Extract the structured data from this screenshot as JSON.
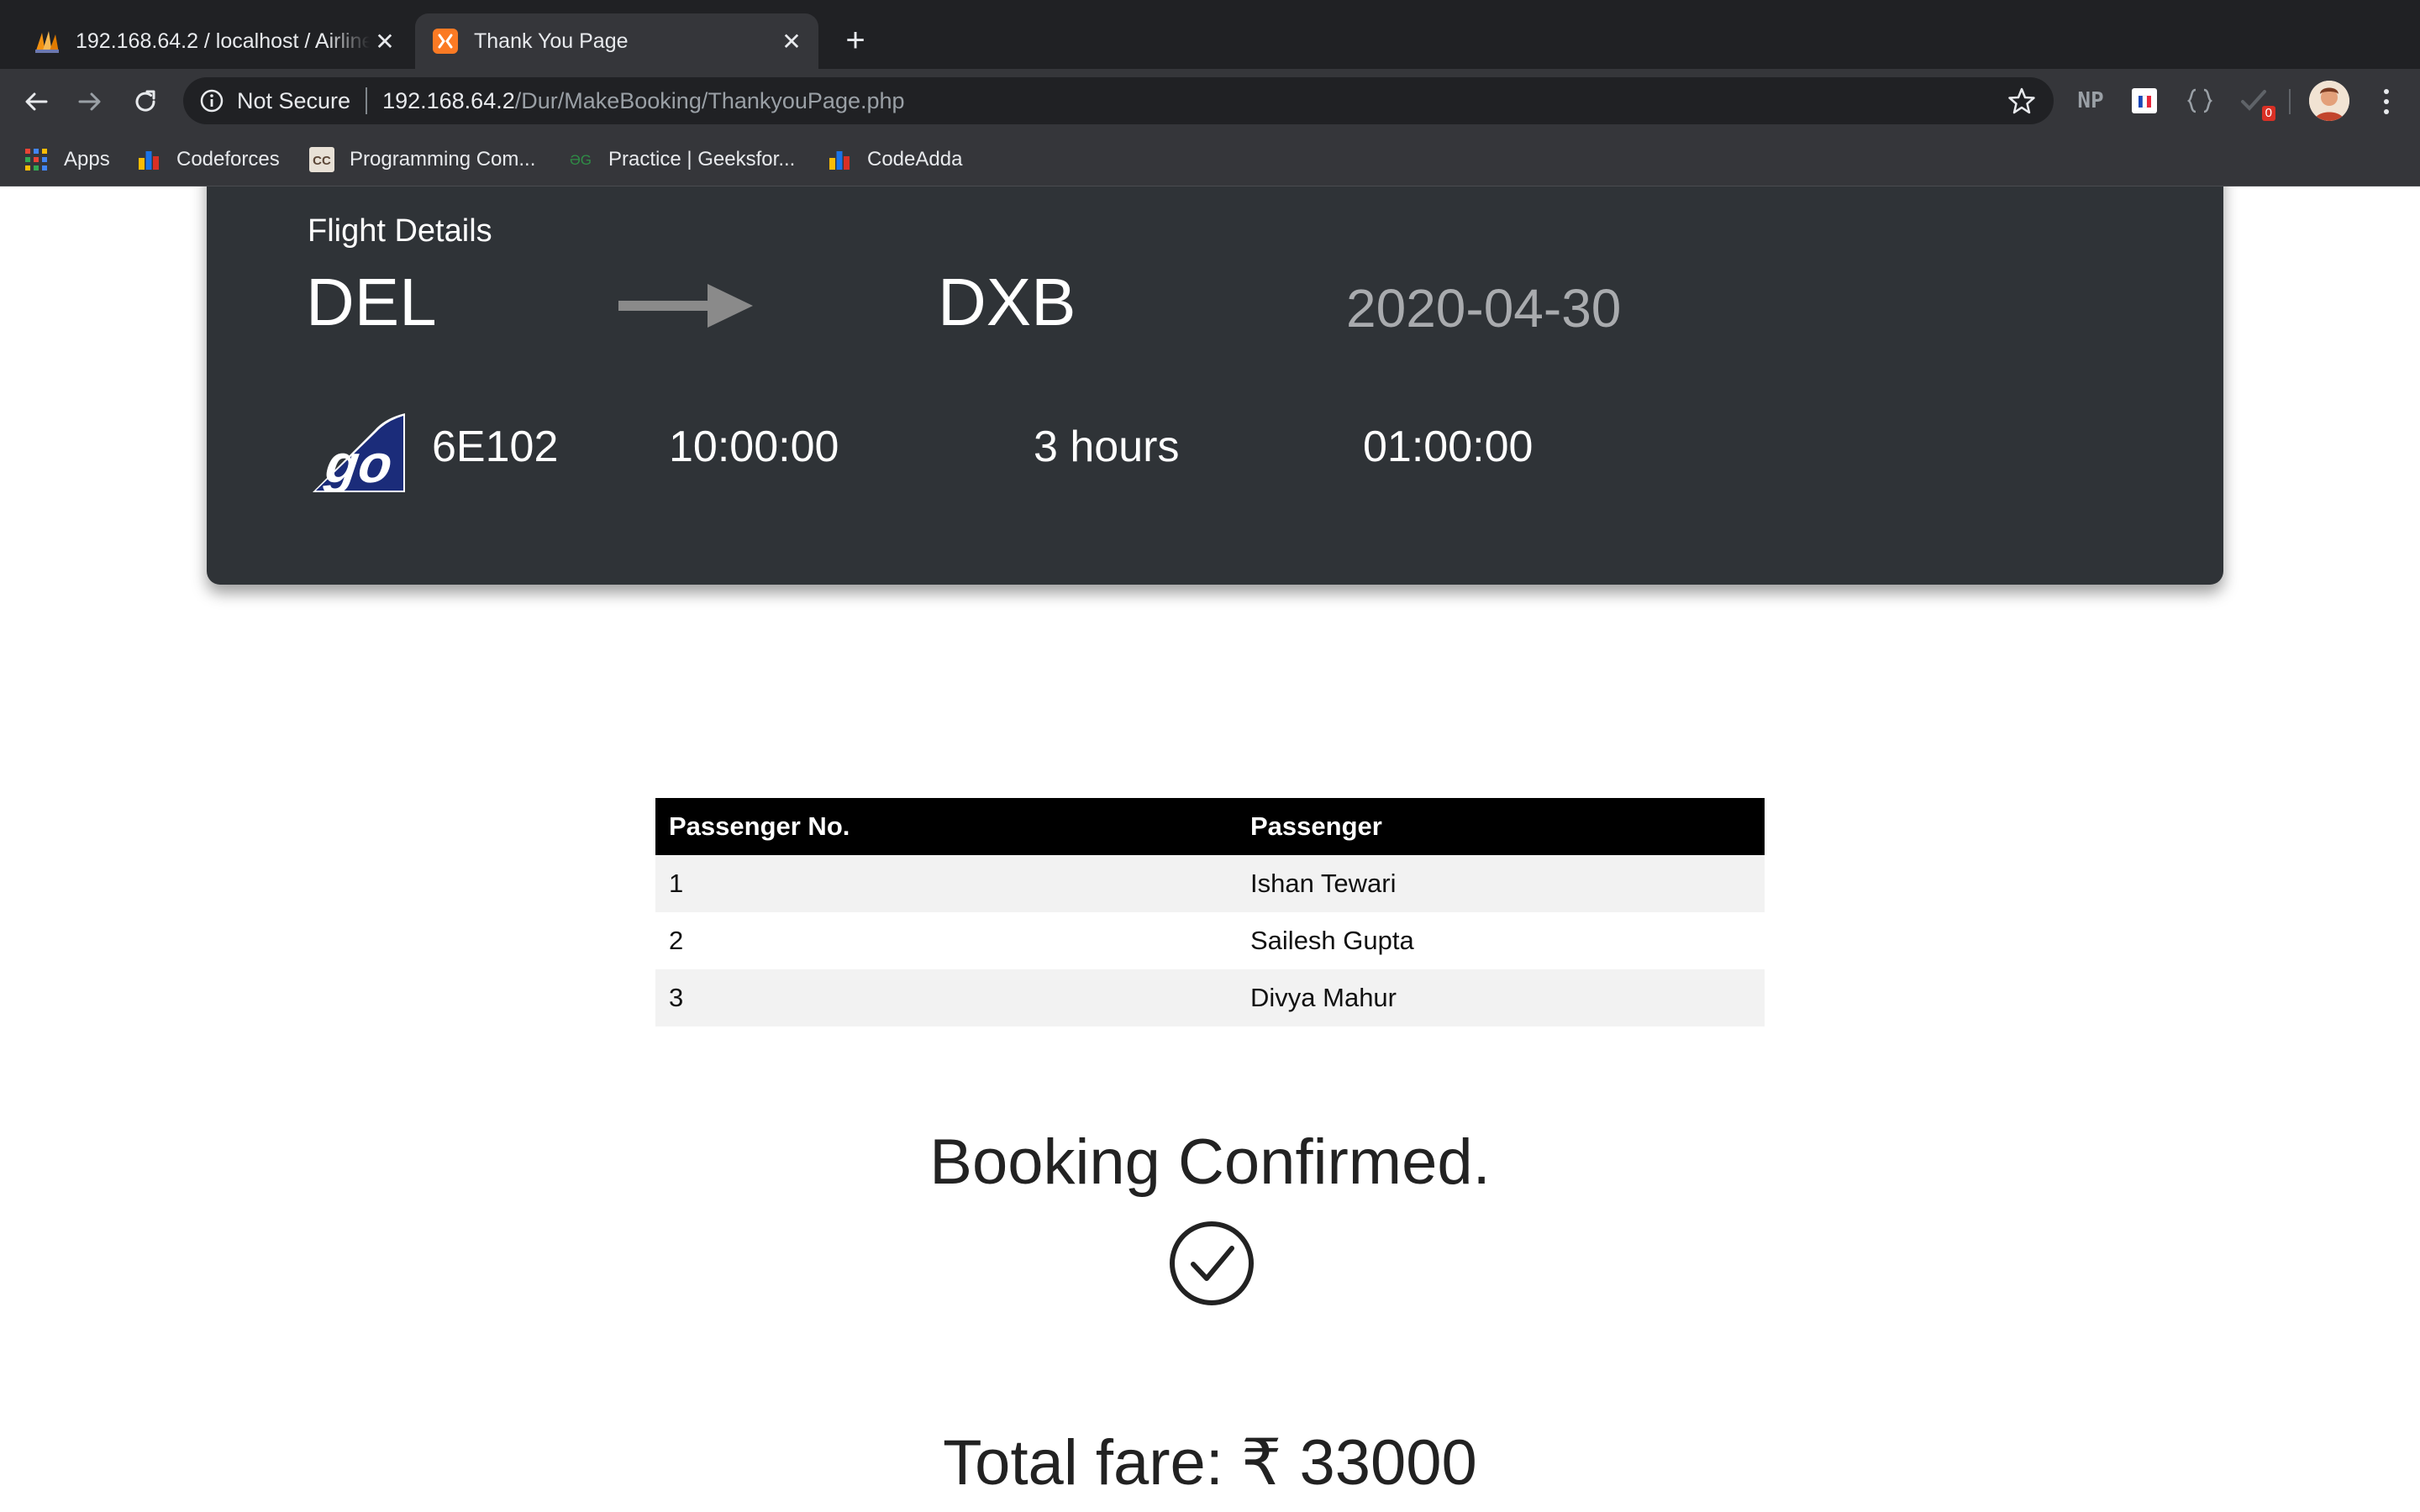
{
  "browser": {
    "tabs": [
      {
        "title": "192.168.64.2 / localhost / Airline",
        "icon": "phpmyadmin-icon",
        "active": false
      },
      {
        "title": "Thank You Page",
        "icon": "xampp-icon",
        "active": true
      }
    ],
    "address_bar": {
      "security_label": "Not Secure",
      "host": "192.168.64.2",
      "path": "/Dur/MakeBooking/ThankyouPage.php"
    },
    "extensions": {
      "np_label": "NP",
      "badge_count": "0"
    },
    "bookmarks": [
      {
        "label": "Apps",
        "icon": "apps-grid-icon"
      },
      {
        "label": "Codeforces",
        "icon": "codeforces-icon"
      },
      {
        "label": "Programming Com...",
        "icon": "codechef-icon"
      },
      {
        "label": "Practice | Geeksfor...",
        "icon": "geeksforgeeks-icon"
      },
      {
        "label": "CodeAdda",
        "icon": "codeadda-icon"
      }
    ]
  },
  "flight": {
    "section_title": "Flight Details",
    "from": "DEL",
    "to": "DXB",
    "date": "2020-04-30",
    "airline_logo": "go-airline-logo",
    "flight_number": "6E102",
    "departure_time": "10:00:00",
    "duration": "3 hours",
    "arrival_time": "01:00:00"
  },
  "passengers": {
    "headers": [
      "Passenger No.",
      "Passenger"
    ],
    "rows": [
      [
        "1",
        "Ishan Tewari"
      ],
      [
        "2",
        "Sailesh Gupta"
      ],
      [
        "3",
        "Divya Mahur"
      ]
    ]
  },
  "confirmation": {
    "message": "Booking Confirmed.",
    "icon": "check-circle-icon"
  },
  "fare": {
    "label": "Total fare: ₹ 33000"
  },
  "colors": {
    "card_bg": "#2f3337",
    "table_header_bg": "#000000",
    "stripe_bg": "#f2f2f2",
    "chrome_dark": "#202124"
  }
}
